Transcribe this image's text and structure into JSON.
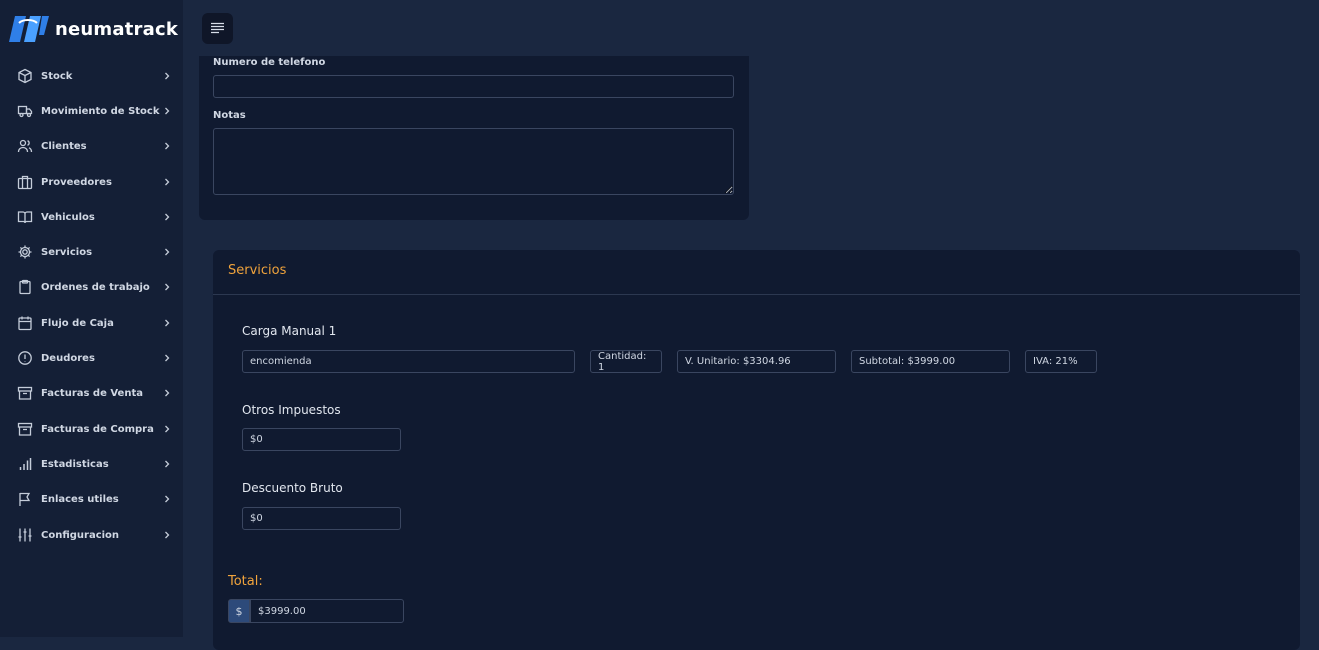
{
  "app": {
    "brand": "neumatrack"
  },
  "sidebar": {
    "items": [
      {
        "label": "Stock",
        "icon": "box-icon"
      },
      {
        "label": "Movimiento de Stock",
        "icon": "truck-icon"
      },
      {
        "label": "Clientes",
        "icon": "users-icon"
      },
      {
        "label": "Proveedores",
        "icon": "building-icon"
      },
      {
        "label": "Vehiculos",
        "icon": "book-icon"
      },
      {
        "label": "Servicios",
        "icon": "gear-icon"
      },
      {
        "label": "Ordenes de trabajo",
        "icon": "clipboard-icon"
      },
      {
        "label": "Flujo de Caja",
        "icon": "calendar-icon"
      },
      {
        "label": "Deudores",
        "icon": "alert-circle-icon"
      },
      {
        "label": "Facturas de Venta",
        "icon": "archive-icon"
      },
      {
        "label": "Facturas de Compra",
        "icon": "archive-icon"
      },
      {
        "label": "Estadisticas",
        "icon": "bar-chart-icon"
      },
      {
        "label": "Enlaces utiles",
        "icon": "flag-icon"
      },
      {
        "label": "Configuracion",
        "icon": "sliders-icon"
      }
    ]
  },
  "form": {
    "phone_label": "Numero de telefono",
    "phone_value": "",
    "notes_label": "Notas",
    "notes_value": ""
  },
  "servicios": {
    "title": "Servicios",
    "item_title": "Carga Manual 1",
    "description": "encomienda",
    "cantidad": "Cantidad: 1",
    "unitario": "V. Unitario: $3304.96",
    "subtotal": "Subtotal: $3999.00",
    "iva": "IVA: 21%",
    "otros_label": "Otros Impuestos",
    "otros_value": "$0",
    "descuento_label": "Descuento Bruto",
    "descuento_value": "$0",
    "total_label": "Total:",
    "currency": "$",
    "total_value": "$3999.00"
  },
  "colors": {
    "accent": "#f0a33c",
    "brand_blue": "#2f7fe8",
    "bg": "#1a2740",
    "sidebar": "#141f36",
    "card": "#101a30"
  }
}
